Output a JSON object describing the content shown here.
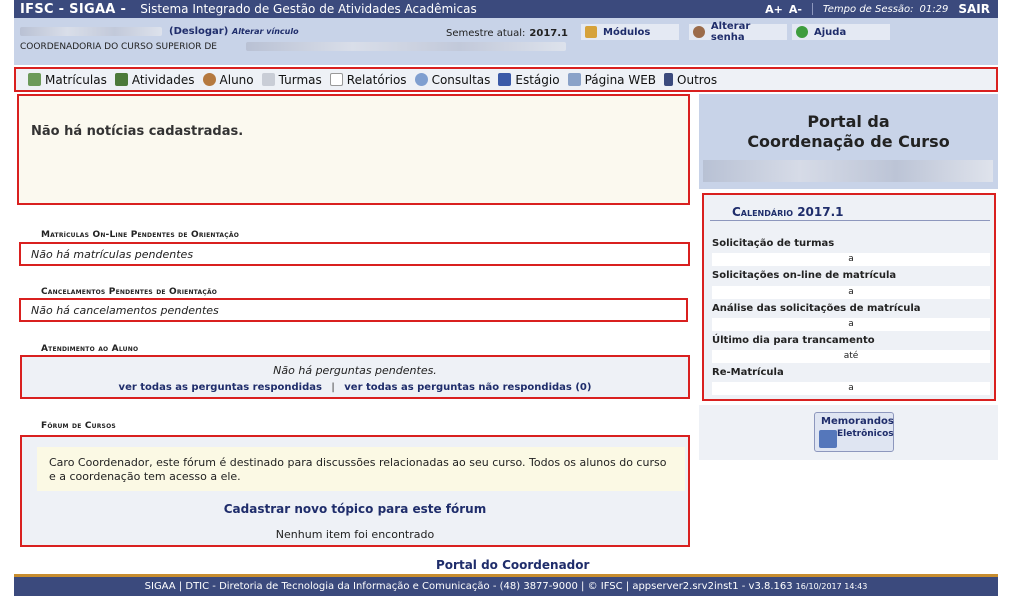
{
  "header": {
    "system": "IFSC - SIGAA -",
    "system_full": "Sistema Integrado de Gestão de Atividades Acadêmicas",
    "font_increase": "A+",
    "font_decrease": "A-",
    "session_label": "Tempo de Sessão:",
    "session_time": "01:29",
    "logout": "SAIR"
  },
  "user": {
    "deslogar": "(Deslogar)",
    "alterar_vinculo": "Alterar vínculo",
    "coordenadoria": "COORDENADORIA DO CURSO SUPERIOR DE",
    "semestre_label": "Semestre atual:",
    "semestre_value": "2017.1"
  },
  "toolbar": {
    "modulos": "Módulos",
    "alterar_senha": "Alterar senha",
    "ajuda": "Ajuda"
  },
  "menu": [
    {
      "label": "Matrículas",
      "icon": "matriculas-icon"
    },
    {
      "label": "Atividades",
      "icon": "atividades-icon"
    },
    {
      "label": "Aluno",
      "icon": "aluno-icon"
    },
    {
      "label": "Turmas",
      "icon": "turmas-icon"
    },
    {
      "label": "Relatórios",
      "icon": "relatorios-icon"
    },
    {
      "label": "Consultas",
      "icon": "consultas-icon"
    },
    {
      "label": "Estágio",
      "icon": "estagio-icon"
    },
    {
      "label": "Página WEB",
      "icon": "pagina-web-icon"
    },
    {
      "label": "Outros",
      "icon": "outros-icon"
    }
  ],
  "news": {
    "empty": "Não há notícias cadastradas."
  },
  "matriculas": {
    "title": "Matrículas On-Line Pendentes de Orientação",
    "empty": "Não há matrículas pendentes"
  },
  "cancelamentos": {
    "title": "Cancelamentos Pendentes de Orientação",
    "empty": "Não há cancelamentos pendentes"
  },
  "atendimento": {
    "title": "Atendimento ao Aluno",
    "empty": "Não há perguntas pendentes.",
    "link_respondidas": "ver todas as perguntas respondidas",
    "separator": "|",
    "link_nao_respondidas": "ver todas as perguntas não respondidas (0)"
  },
  "forum": {
    "title": "Fórum de Cursos",
    "message": "Caro Coordenador, este fórum é destinado para discussões relacionadas ao seu curso. Todos os alunos do curso e a coordenação tem acesso a ele.",
    "cadastrar": "Cadastrar novo tópico para este fórum",
    "empty": "Nenhum item foi encontrado"
  },
  "portal_link": "Portal do Coordenador",
  "portal": {
    "title_line1": "Portal da",
    "title_line2": "Coordenação de Curso"
  },
  "calendario": {
    "title": "Calendário 2017.1",
    "items": [
      {
        "label": "Solicitação de turmas",
        "value": "a"
      },
      {
        "label": "Solicitações on-line de matrícula",
        "value": "a"
      },
      {
        "label": "Análise das solicitações de matrícula",
        "value": "a"
      },
      {
        "label": "Último dia para trancamento",
        "value": "até"
      },
      {
        "label": "Re-Matrícula",
        "value": "a"
      }
    ]
  },
  "memorandos": {
    "line1": "Memorandos",
    "line2": "Eletrônicos"
  },
  "footer": {
    "text": "SIGAA | DTIC - Diretoria de Tecnologia da Informação e Comunicação - (48) 3877-9000 | © IFSC | appserver2.srv2inst1 - v3.8.163",
    "date": "16/10/2017 14:43"
  },
  "colors": {
    "header_bg": "#3b4a7d",
    "panel_bg": "#c8d3e8",
    "highlight_border": "#d9201f",
    "link": "#1f2d6b"
  }
}
